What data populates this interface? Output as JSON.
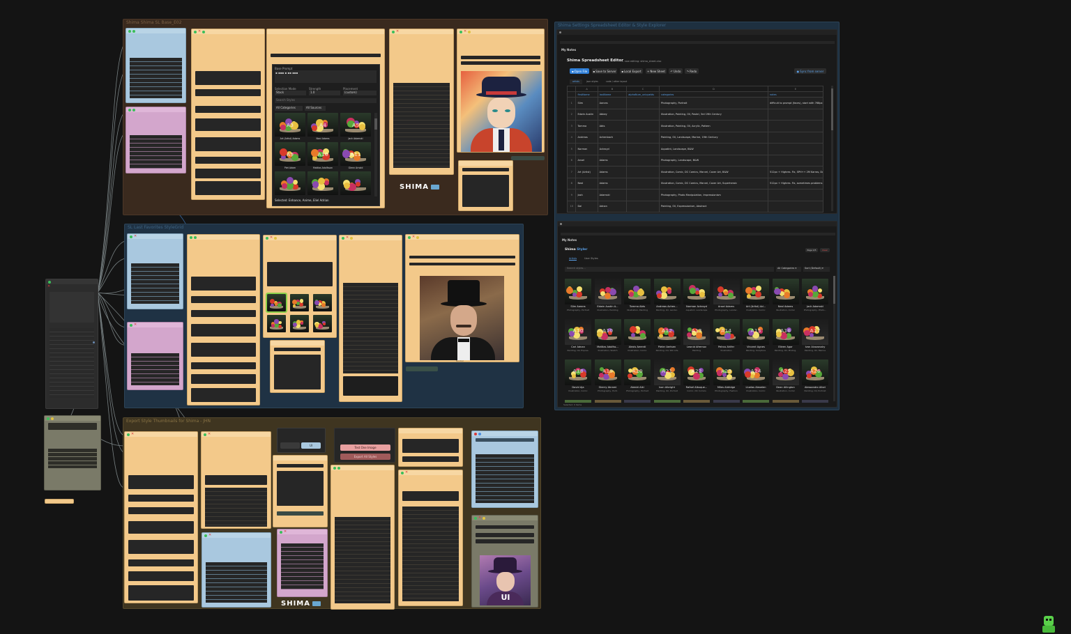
{
  "colors": {
    "canvas_bg": "#141414",
    "group_brown": "#3a2a1e",
    "group_navy": "#1f3244",
    "group_olive": "#3f3520",
    "node_orange": "#f3c98a",
    "node_blue": "#a9c8df",
    "node_pink": "#d3a6cc",
    "accent_blue": "#2f7fd8",
    "accent_red": "#c83a3a",
    "wire": "#9aa6a8"
  },
  "groups": {
    "g1": "Shima Shima SL Base_E02",
    "g2": "SL Last Favorites StyleGrid",
    "g3": "Export Style Thumbnails for Shima - JHN",
    "g4": "Shima Settings Spreadsheet Editor & Style Explorer"
  },
  "style_selector": {
    "label": "Base Prompt",
    "prompt_value": "▪ ▪▪▪ ▪ ▪▪ ▪▪▪",
    "col1_label": "Selection Mode",
    "col1_value": "Stack",
    "col2_label": "Strength",
    "col2_value": "1.0",
    "col3_label": "Placement",
    "col3_value": "(custom)",
    "search_placeholder": "Search Styles",
    "filter1": "All Categories",
    "filter2": "All Sources",
    "thumbs": [
      {
        "name": "Art (Artist) Adams",
        "badge": "A3"
      },
      {
        "name": "Nani Adams",
        "badge": "A4"
      },
      {
        "name": "Jack Adamski",
        "badge": "A5"
      },
      {
        "name": "Piet Adam",
        "badge": "A9"
      },
      {
        "name": "Mattias Adolfsson",
        "badge": "A10"
      },
      {
        "name": "Glenn Arnold",
        "badge": "A11"
      },
      {
        "name": "",
        "badge": ""
      },
      {
        "name": "",
        "badge": ""
      },
      {
        "name": "",
        "badge": ""
      }
    ],
    "selected_text": "Selected: Enhance, Anime, Eliel Adrian"
  },
  "logo_text": "SHIMA",
  "sheet_node": {
    "tab_label": "My Notes",
    "title": "Shima Spreadsheet Editor",
    "subtitle": "— now editing: shima_sheet.xlsx",
    "buttons": {
      "open_file": "Open File",
      "save_server": "Save to Server",
      "local_export": "Local Export",
      "new_sheet": "New Sheet",
      "undo": "Undo",
      "redo": "Redo",
      "sync": "Sync from server"
    },
    "sheet_tabs": [
      "artists",
      "json styles",
      "code / other layout"
    ],
    "col_letters": [
      "",
      "A",
      "B",
      "C",
      "D",
      "E"
    ],
    "headers": [
      "",
      "firstName",
      "lastName",
      "alphaNum_uniqueIds",
      "categories",
      "notes"
    ],
    "rows": [
      [
        "1",
        "Slim",
        "Aarons",
        "",
        "Photography, Portrait",
        "difficult to prompt (faces), start with 768px + Highres. Fix"
      ],
      [
        "2",
        "Edwin Austin",
        "Abbey",
        "",
        "Illustration, Painting, Oil, Pastel, 3rd 19th Century",
        ""
      ],
      [
        "3",
        "Tomma",
        "Abts",
        "",
        "Illustration, Painting, Oil, Acrylic, Pattern",
        ""
      ],
      [
        "4",
        "Andreas",
        "Achenbach",
        "",
        "Painting, Oil, Landscape, Marine, 19th Century",
        ""
      ],
      [
        "5",
        "Norman",
        "Ackroyd",
        "",
        "Aquatint, Landscape, B&W",
        ""
      ],
      [
        "6",
        "Ansel",
        "Adams",
        "",
        "Photography, Landscape, B&W",
        ""
      ],
      [
        "7",
        "Art (Artist)",
        "Adams",
        "",
        "Illustration, Comic, DC Comics, Marvel, Cover Art, B&W",
        "512px + Highres. Fix, SPH++ 2M Karras, Denoising 0.5"
      ],
      [
        "8",
        "Neal",
        "Adams",
        "",
        "Illustration, Comic, DC Comics, Marvel, Cover Art, Superheroic",
        "512px + Highres. Fix, sometimes problems with eyes"
      ],
      [
        "9",
        "Josh",
        "Adamski",
        "",
        "Photography, Photo Manipulation, Impressionism",
        ""
      ],
      [
        "10",
        "Dal",
        "Adnan",
        "",
        "Painting, Oil, Expressionism, Abstract",
        ""
      ]
    ]
  },
  "styler_node": {
    "tab_label": "My Notes",
    "title_a": "Shima",
    "title_b": "Styler",
    "tabs": [
      "Artists",
      "User Styles"
    ],
    "btn_page": "Page 0/5",
    "btn_clear": "Clear",
    "search_placeholder": "Search styles...",
    "filter_categories": "All Categories",
    "filter_sort": "Sort (Default)",
    "selected_footer": "Selected: 0 items",
    "cells": [
      {
        "name": "Slim Aarons",
        "sub": "Photography, Portrait"
      },
      {
        "name": "Edwin Austin A...",
        "sub": "Illustration, Painting"
      },
      {
        "name": "Tomma Abts",
        "sub": "Illustration, Painting"
      },
      {
        "name": "Andreas Achen...",
        "sub": "Painting, Oil, Landsc."
      },
      {
        "name": "Norman Ackroyd",
        "sub": "Aquatint, Landscape"
      },
      {
        "name": "Ansel Adams",
        "sub": "Photography, Landsc."
      },
      {
        "name": "Art (Artist) Ad...",
        "sub": "Illustration, Comic"
      },
      {
        "name": "Neal Adams",
        "sub": "Illustration, Comic"
      },
      {
        "name": "Jack Adamski",
        "sub": "Photography, Photo..."
      },
      {
        "name": "Carl Adnan",
        "sub": "Painting, Oil, Expres."
      },
      {
        "name": "Mattias Adolfss...",
        "sub": "Illustration, Sketch"
      },
      {
        "name": "Alexis Aerenti",
        "sub": "Illustration, Comic"
      },
      {
        "name": "Pieter Aertsen",
        "sub": "Painting, Oil, Still Life"
      },
      {
        "name": "Leonid Afremov",
        "sub": "Painting"
      },
      {
        "name": "Petrus Ahlfer",
        "sub": "Illustration"
      },
      {
        "name": "Vincent Agnes",
        "sub": "Painting, Sculpture"
      },
      {
        "name": "Eileen Agar",
        "sub": "Painting, Oil, Photog."
      },
      {
        "name": "Ivan Aivazovsky",
        "sub": "Painting, Oil, Marine"
      },
      {
        "name": "David Aja",
        "sub": "Illustration, Comic"
      },
      {
        "name": "Sherry Akrami",
        "sub": "Photography, Portr."
      },
      {
        "name": "Akeshi Aiki",
        "sub": "Photography, Portrait"
      },
      {
        "name": "Ivan Albright",
        "sub": "Painting, Oil, Portrait"
      },
      {
        "name": "Rafael Albuque...",
        "sub": "Comic, DC Comics"
      },
      {
        "name": "Miles Aldridge",
        "sub": "Photography, Fashion"
      },
      {
        "name": "Lluelas Alexeien",
        "sub": "Illustration, Comic"
      },
      {
        "name": "Dean Allington",
        "sub": "Illustration, Comic"
      },
      {
        "name": "Alessandro Allori",
        "sub": "Painting, Oil, Portrait"
      }
    ],
    "badges": [
      "",
      "",
      "",
      "",
      "",
      "",
      "",
      "",
      "",
      "A10",
      "A10",
      "",
      "A12",
      "A13",
      "A14",
      "A15",
      "A16",
      "A17",
      "A18",
      "A19",
      "A20",
      "A21",
      "A22",
      "A23",
      "A24",
      "A25",
      "A26"
    ]
  },
  "export_node": {
    "btn_test": "Test One Image",
    "btn_run": "Export All Styles",
    "mini_btn": "UI"
  },
  "portrait_caption": "Nonbar"
}
